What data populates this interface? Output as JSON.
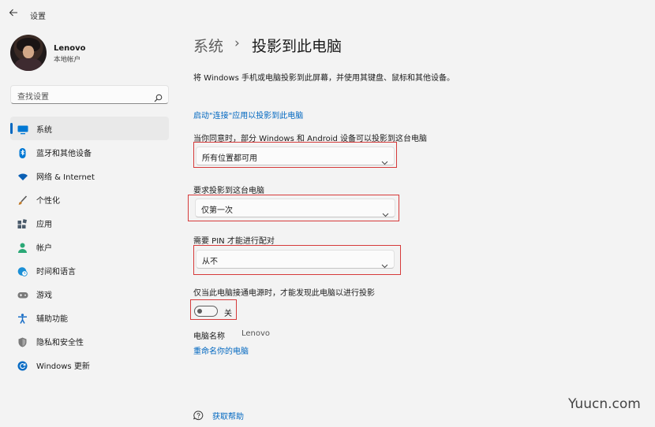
{
  "window": {
    "title": "设置",
    "back_icon": "back-arrow-icon"
  },
  "profile": {
    "name": "Lenovo",
    "account_type": "本地帐户"
  },
  "search": {
    "placeholder": "查找设置",
    "icon": "search-icon"
  },
  "sidebar": {
    "items": [
      {
        "label": "系统",
        "icon": "monitor-icon",
        "active": true,
        "color": "#0078d4"
      },
      {
        "label": "蓝牙和其他设备",
        "icon": "bluetooth-icon",
        "color": "#0078d4"
      },
      {
        "label": "网络 & Internet",
        "icon": "wifi-icon",
        "color": "#0a5fb4"
      },
      {
        "label": "个性化",
        "icon": "brush-icon",
        "color": "#c17b2b"
      },
      {
        "label": "应用",
        "icon": "apps-icon",
        "color": "#4a5a6a"
      },
      {
        "label": "帐户",
        "icon": "person-icon",
        "color": "#2aa876"
      },
      {
        "label": "时间和语言",
        "icon": "globe-clock-icon",
        "color": "#1b8fd6"
      },
      {
        "label": "游戏",
        "icon": "gamepad-icon",
        "color": "#6b6b6b"
      },
      {
        "label": "辅助功能",
        "icon": "accessibility-icon",
        "color": "#1b6fc7"
      },
      {
        "label": "隐私和安全性",
        "icon": "shield-icon",
        "color": "#6b6b6b"
      },
      {
        "label": "Windows 更新",
        "icon": "update-icon",
        "color": "#0a6cc4"
      }
    ]
  },
  "header": {
    "parent": "系统",
    "separator": "›",
    "current": "投影到此电脑"
  },
  "main": {
    "description": "将 Windows 手机或电脑投影到此屏幕，并使用其键盘、鼠标和其他设备。",
    "connect_link": "启动\"连接\"应用以投影到此电脑",
    "availability": {
      "label": "当你同意时，部分 Windows 和 Android 设备可以投影到这台电脑",
      "value": "所有位置都可用"
    },
    "ask_to_project": {
      "label": "要求投影到这台电脑",
      "value": "仅第一次"
    },
    "require_pin": {
      "label": "需要 PIN 才能进行配对",
      "value": "从不"
    },
    "power_only": {
      "label": "仅当此电脑接通电源时，才能发现此电脑以进行投影",
      "toggle_text": "关",
      "on": false
    },
    "pc_name": {
      "label": "电脑名称",
      "value": "Lenovo",
      "rename_link": "重命名你的电脑"
    }
  },
  "help": {
    "label": "获取帮助",
    "icon": "help-chat-icon"
  },
  "watermark": "Yuucn.com",
  "colors": {
    "accent": "#0067c0",
    "highlight_box": "#d63a3a",
    "background": "#f3f3f3"
  }
}
